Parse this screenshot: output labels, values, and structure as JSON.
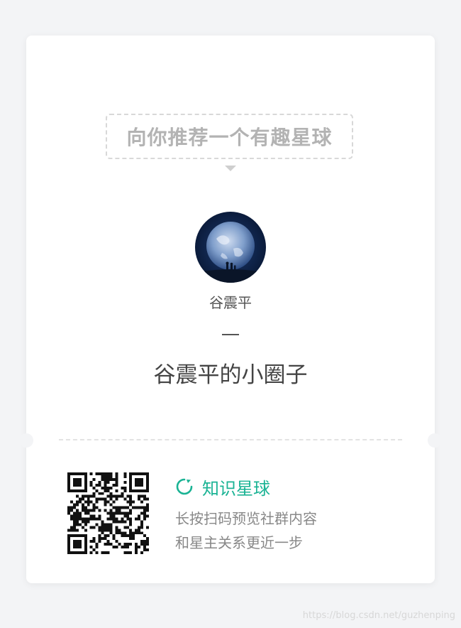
{
  "banner": {
    "text": "向你推荐一个有趣星球"
  },
  "owner": {
    "name": "谷震平",
    "avatar_icon": "earth-avatar-icon"
  },
  "circle": {
    "title": "谷震平的小圈子"
  },
  "footer": {
    "brand_name": "知识星球",
    "brand_icon": "refresh-ring-icon",
    "brand_color": "#1ab394",
    "description_line1": "长按扫码预览社群内容",
    "description_line2": "和星主关系更近一步"
  },
  "watermark": "https://blog.csdn.net/guzhenping"
}
